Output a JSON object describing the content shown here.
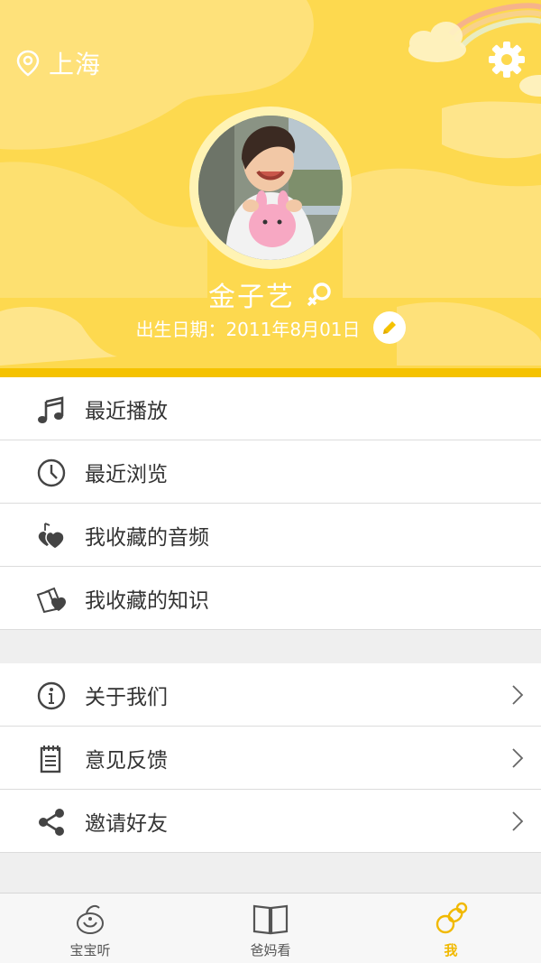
{
  "location": {
    "city": "上海",
    "icon": "location-pin-icon"
  },
  "settings": {
    "icon": "gear-icon"
  },
  "profile": {
    "name": "金子艺",
    "gender_icon": "female-symbol-icon",
    "birth_label": "出生日期：2011年8月01日",
    "edit_icon": "pencil-icon"
  },
  "menu_primary": [
    {
      "label": "最近播放",
      "icon": "music-note-icon"
    },
    {
      "label": "最近浏览",
      "icon": "clock-icon"
    },
    {
      "label": "我收藏的音频",
      "icon": "heart-note-icon"
    },
    {
      "label": "我收藏的知识",
      "icon": "heart-book-icon"
    }
  ],
  "menu_secondary": [
    {
      "label": "关于我们",
      "icon": "info-icon"
    },
    {
      "label": "意见反馈",
      "icon": "notepad-icon"
    },
    {
      "label": "邀请好友",
      "icon": "share-icon"
    }
  ],
  "tabs": [
    {
      "label": "宝宝听",
      "icon": "baby-listen-icon",
      "active": false
    },
    {
      "label": "爸妈看",
      "icon": "book-icon",
      "active": false
    },
    {
      "label": "我",
      "icon": "pacifier-icon",
      "active": true
    }
  ],
  "colors": {
    "header_bg": "#fdd94f",
    "header_stripe": "#f5c200",
    "accent": "#f1b900"
  }
}
